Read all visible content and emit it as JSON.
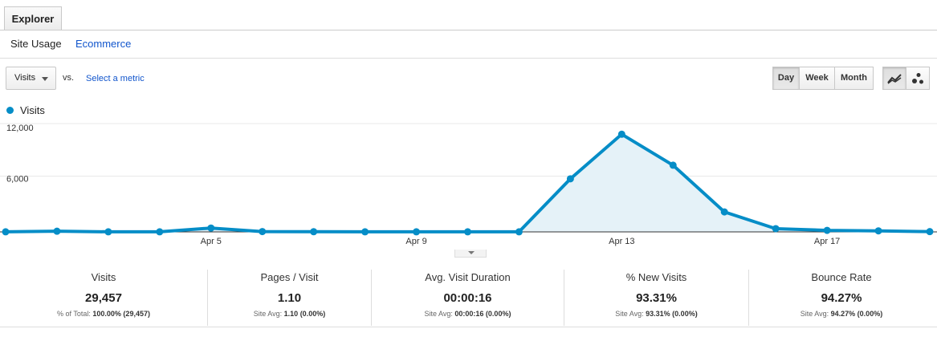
{
  "tabs": [
    {
      "label": "Explorer"
    }
  ],
  "subnav": {
    "site_usage": "Site Usage",
    "ecommerce": "Ecommerce"
  },
  "controls": {
    "metric": "Visits",
    "vs": "vs.",
    "select_metric": "Select a metric",
    "granularity": [
      "Day",
      "Week",
      "Month"
    ],
    "selected_granularity": "Day",
    "chart_modes": [
      "line-chart-icon",
      "motion-chart-icon"
    ]
  },
  "legend": {
    "label": "Visits",
    "color": "#058dc7"
  },
  "chart_data": {
    "type": "area",
    "title": "",
    "xlabel": "",
    "ylabel": "",
    "ylim": [
      0,
      12000
    ],
    "y_ticks": [
      "12,000",
      "6,000"
    ],
    "x_tick_labels": [
      "Apr 5",
      "Apr 9",
      "Apr 13",
      "Apr 17"
    ],
    "series": [
      {
        "name": "Visits",
        "color": "#058dc7",
        "x": [
          "Apr 1",
          "Apr 2",
          "Apr 3",
          "Apr 4",
          "Apr 5",
          "Apr 6",
          "Apr 7",
          "Apr 8",
          "Apr 9",
          "Apr 10",
          "Apr 11",
          "Apr 12",
          "Apr 13",
          "Apr 14",
          "Apr 15",
          "Apr 16",
          "Apr 17",
          "Apr 18",
          "Apr 19"
        ],
        "values": [
          10,
          80,
          10,
          10,
          450,
          40,
          20,
          10,
          10,
          10,
          10,
          6250,
          11500,
          7850,
          2350,
          380,
          180,
          120,
          30
        ]
      }
    ]
  },
  "summary": [
    {
      "label": "Visits",
      "value": "29,457",
      "sub_prefix": "% of Total:",
      "sub_bold": "100.00% (29,457)"
    },
    {
      "label": "Pages / Visit",
      "value": "1.10",
      "sub_prefix": "Site Avg:",
      "sub_bold": "1.10 (0.00%)"
    },
    {
      "label": "Avg. Visit Duration",
      "value": "00:00:16",
      "sub_prefix": "Site Avg:",
      "sub_bold": "00:00:16 (0.00%)"
    },
    {
      "label": "% New Visits",
      "value": "93.31%",
      "sub_prefix": "Site Avg:",
      "sub_bold": "93.31% (0.00%)"
    },
    {
      "label": "Bounce Rate",
      "value": "94.27%",
      "sub_prefix": "Site Avg:",
      "sub_bold": "94.27% (0.00%)"
    }
  ]
}
